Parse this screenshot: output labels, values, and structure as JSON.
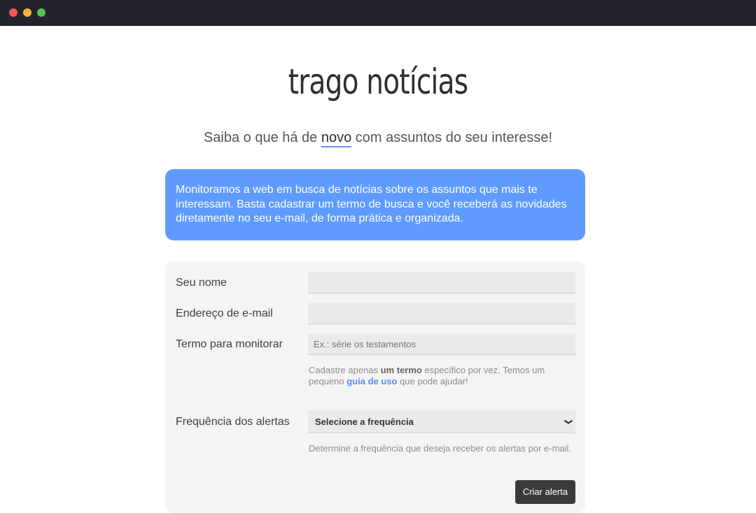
{
  "brand": {
    "logo_text": "trago notícias"
  },
  "tagline": {
    "before": "Saiba o que há de ",
    "highlight": "novo",
    "after": " com assuntos do seu interesse!"
  },
  "info": {
    "text": "Monitoramos a web em busca de notícias sobre os assuntos que mais te interessam. Basta cadastrar um termo de busca e você receberá as novidades diretamente no seu e-mail, de forma prática e organizada."
  },
  "form": {
    "name_label": "Seu nome",
    "email_label": "Endereço de e-mail",
    "term_label": "Termo para monitorar",
    "term_placeholder": "Ex.: série os testamentos",
    "term_help_1": "Cadastre apenas ",
    "term_help_bold": "um termo",
    "term_help_2": " específico por vez. Temos um pequeno ",
    "term_help_link": "guia de uso",
    "term_help_3": " que pode ajudar!",
    "frequency_label": "Frequência dos alertas",
    "frequency_selected": "Selecione a frequência",
    "frequency_help": "Determine a frequência que deseja receber os alertas por e-mail.",
    "submit_label": "Criar alerta"
  },
  "colors": {
    "accent": "#5f9bff",
    "link": "#5b8def",
    "titlebar": "#23232b"
  }
}
